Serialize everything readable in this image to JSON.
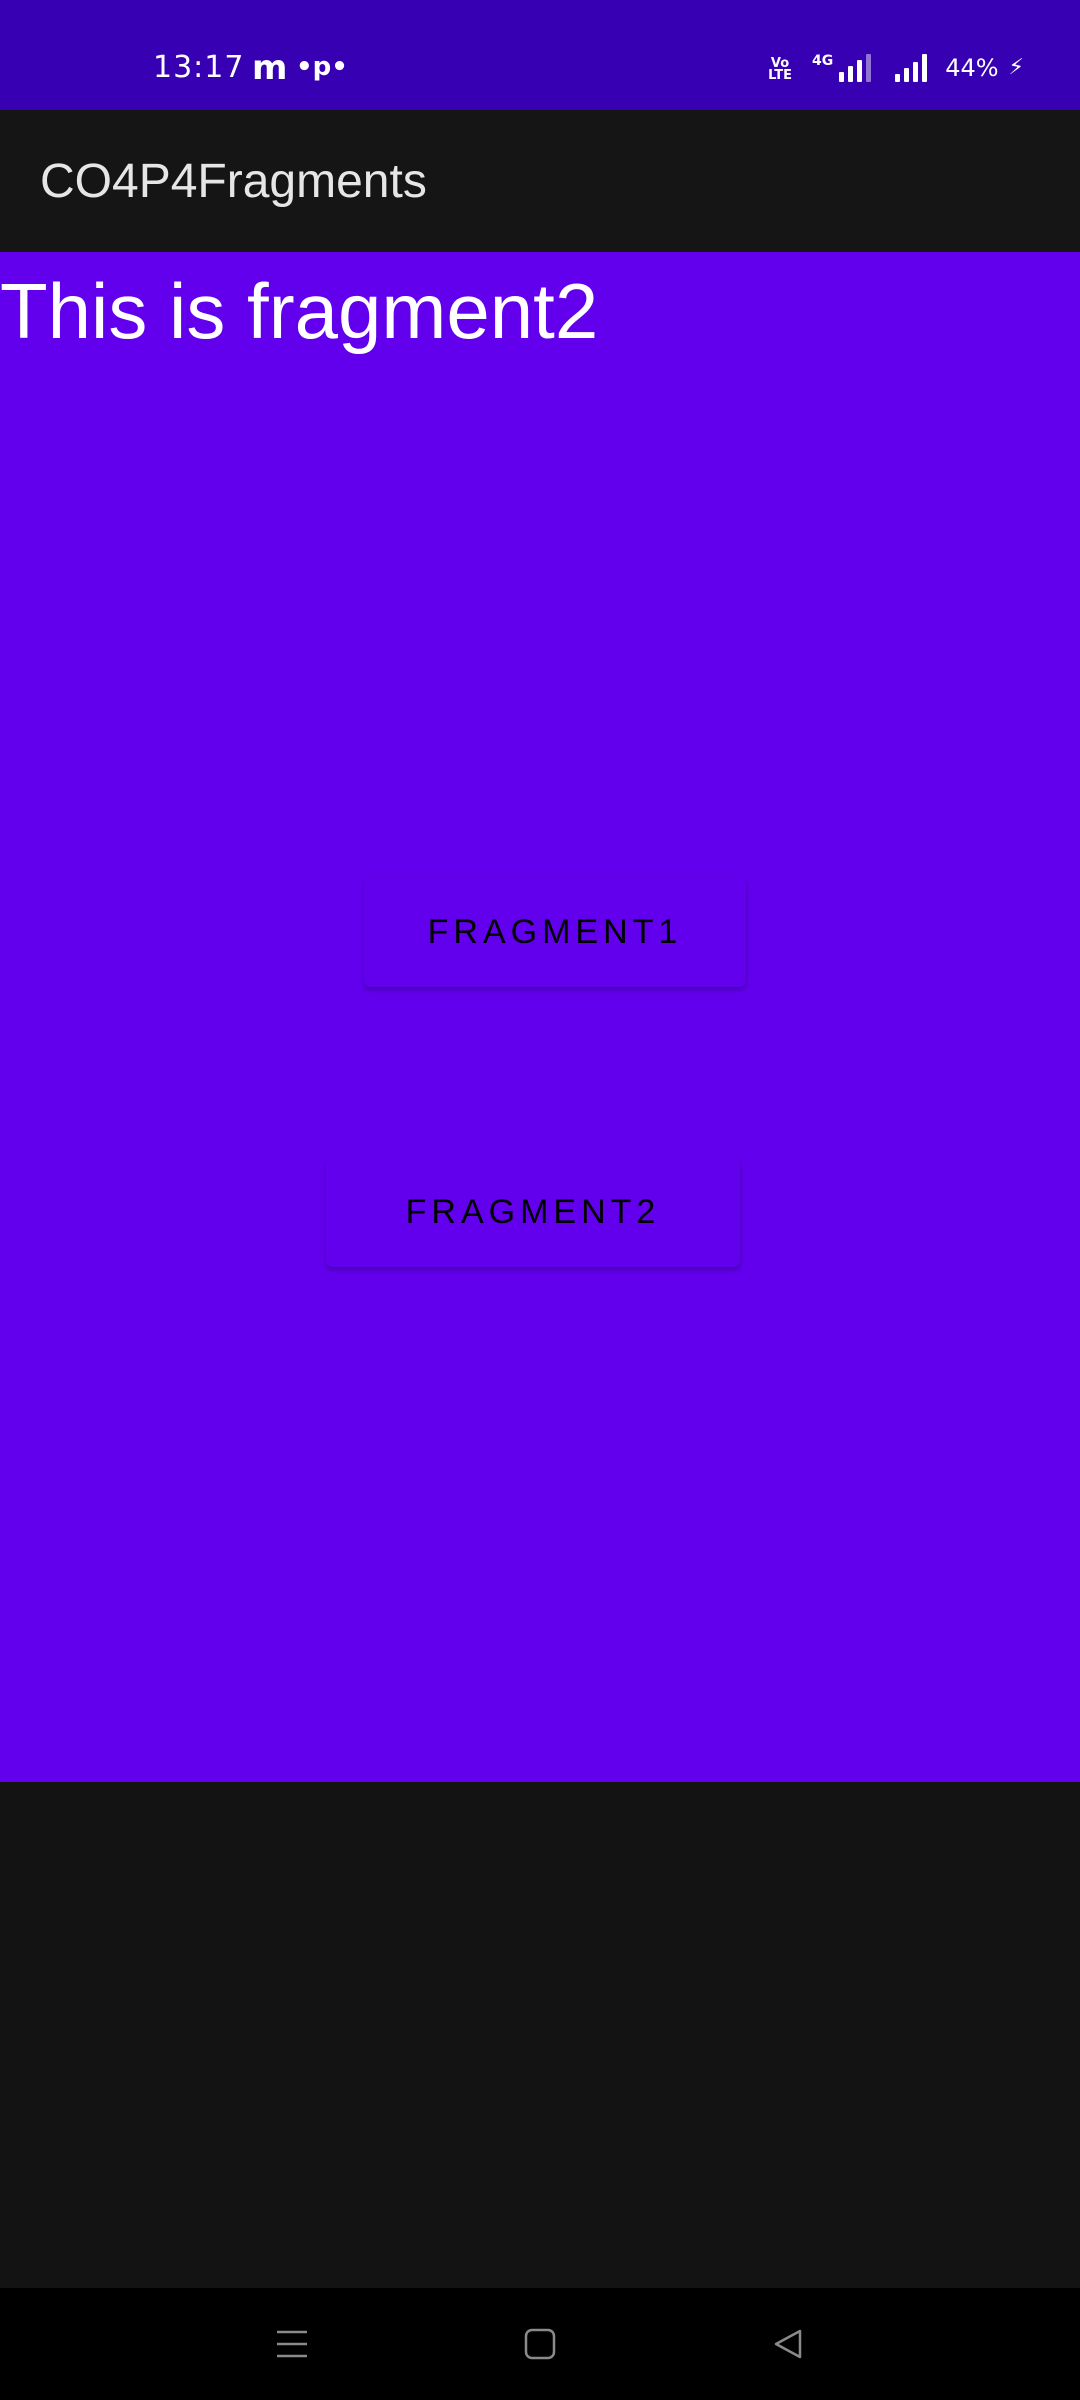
{
  "status_bar": {
    "time": "13:17",
    "notif_icon_1": "m",
    "notif_icon_2": "•p•",
    "volte_label_top": "Vo",
    "volte_label_bottom": "LTE",
    "network_type": "4G",
    "battery": "44%",
    "bg_color": "#3700b3"
  },
  "app_bar": {
    "title": "CO4P4Fragments"
  },
  "content": {
    "heading": "This is fragment2",
    "bg_color": "#6200ee",
    "buttons": [
      {
        "label": "FRAGMENT1"
      },
      {
        "label": "FRAGMENT2"
      }
    ]
  },
  "nav_bar": {
    "icons": [
      "recent-apps-icon",
      "home-icon",
      "back-icon"
    ]
  }
}
